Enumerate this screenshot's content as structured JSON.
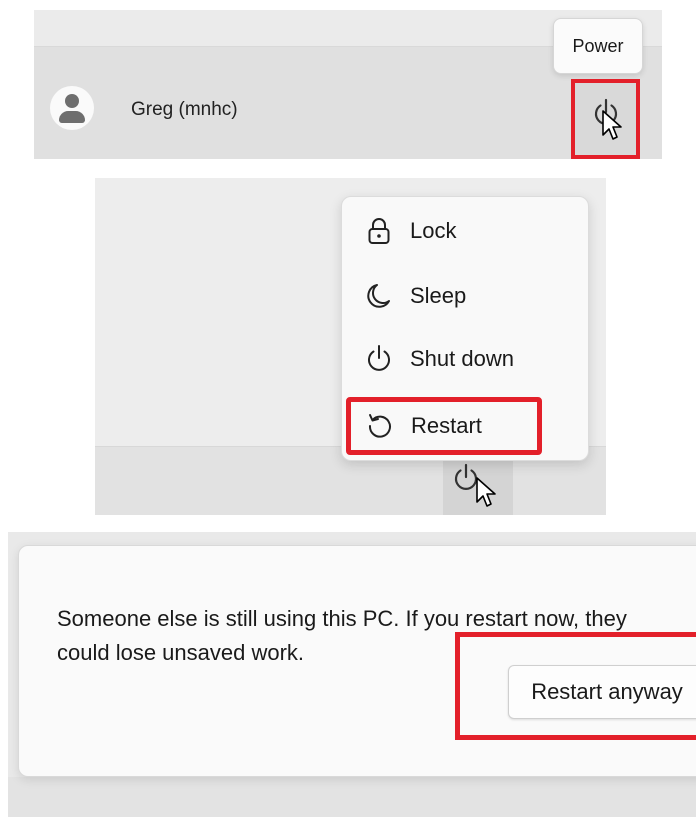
{
  "user_row": {
    "username": "Greg (mnhc)",
    "tooltip": "Power",
    "avatar_icon": "user-avatar-icon",
    "power_icon": "power-icon"
  },
  "power_menu": {
    "items": [
      {
        "label": "Lock",
        "icon": "lock-icon"
      },
      {
        "label": "Sleep",
        "icon": "moon-icon"
      },
      {
        "label": "Shut down",
        "icon": "power-icon"
      },
      {
        "label": "Restart",
        "icon": "restart-icon"
      }
    ]
  },
  "dialog": {
    "message": "Someone else is still using this PC. If you restart now, they could lose unsaved work.",
    "button_label": "Restart anyway"
  },
  "colors": {
    "highlight": "#e3202a",
    "panel_bg": "#ececec",
    "menu_bg": "#f9f9f9"
  }
}
